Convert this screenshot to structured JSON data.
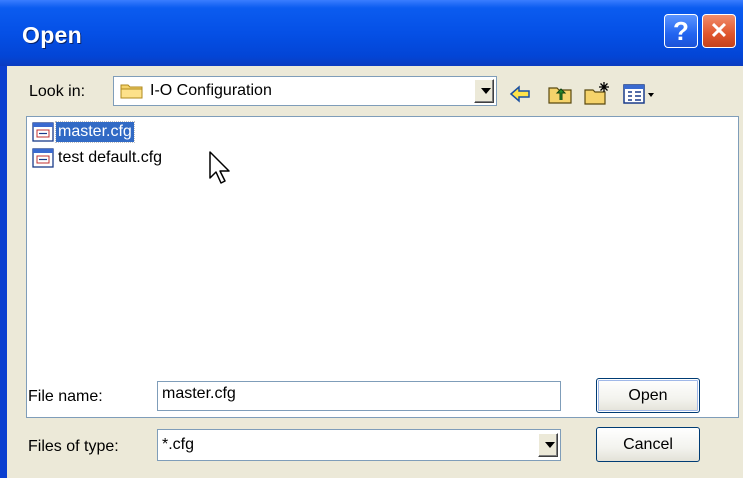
{
  "dialog": {
    "title": "Open",
    "help_label": "?",
    "close_label": "✕"
  },
  "look_in": {
    "label": "Look in:",
    "value": "I-O Configuration"
  },
  "toolbar": {
    "back_icon": "back-arrow-icon",
    "up_icon": "up-folder-icon",
    "new_folder_icon": "new-folder-icon",
    "view_menu_icon": "view-menu-icon"
  },
  "files": [
    {
      "name": "master.cfg",
      "selected": true
    },
    {
      "name": "test default.cfg",
      "selected": false
    }
  ],
  "file_name": {
    "label": "File name:",
    "value": "master.cfg"
  },
  "file_type": {
    "label": "Files of type:",
    "value": "*.cfg"
  },
  "buttons": {
    "open": "Open",
    "cancel": "Cancel"
  },
  "colors": {
    "titlebar": "#0550e6",
    "selection": "#316ac5",
    "face": "#ece9d8"
  }
}
